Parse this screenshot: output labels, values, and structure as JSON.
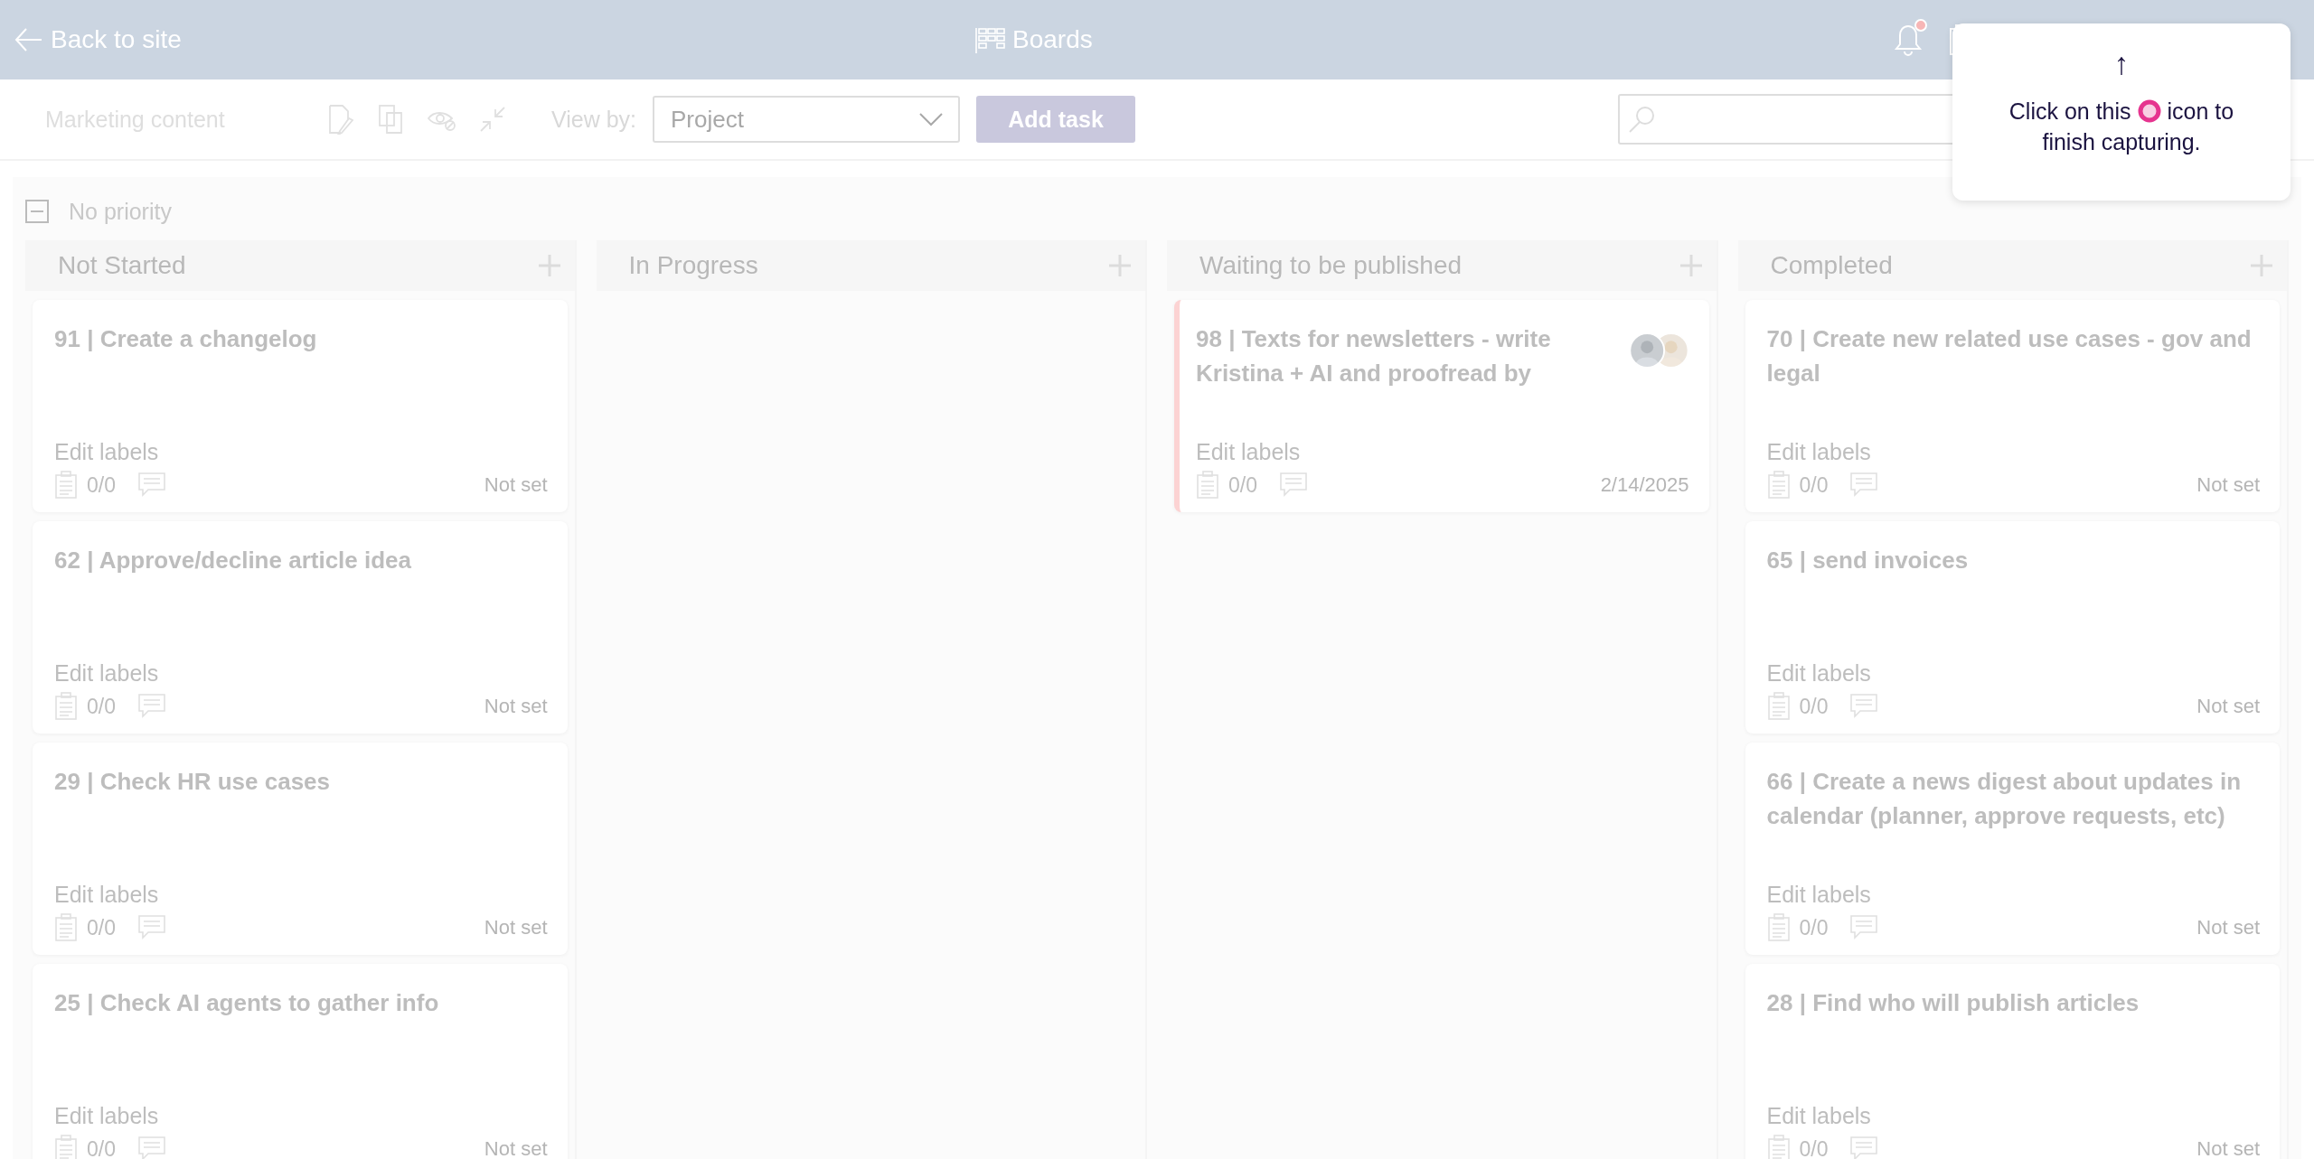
{
  "header": {
    "back_link": "Back to site",
    "title": "Boards",
    "notification": true
  },
  "toolbar": {
    "board_name": "Marketing content",
    "view_by_label": "View by:",
    "view_by": {
      "value": "Project"
    },
    "add_task": "Add task"
  },
  "group": {
    "label": "No priority",
    "expanded": true
  },
  "columns": [
    {
      "title": "Not Started",
      "cards": [
        {
          "title": "91 | Create a changelog",
          "labels": "Edit labels",
          "checklist": "0/0",
          "due": "Not set",
          "flagged": false
        },
        {
          "title": "62 | Approve/decline article idea",
          "labels": "Edit labels",
          "checklist": "0/0",
          "due": "Not set",
          "flagged": false
        },
        {
          "title": "29 | Check HR use cases",
          "labels": "Edit labels",
          "checklist": "0/0",
          "due": "Not set",
          "flagged": false
        },
        {
          "title": "25 | Check AI agents to gather info",
          "labels": "Edit labels",
          "checklist": "0/0",
          "due": "Not set",
          "flagged": false
        }
      ]
    },
    {
      "title": "In Progress"
    },
    {
      "title": "Waiting to be published",
      "cards": [
        {
          "title": "98 | Texts for newsletters - write Kristina + AI and proofread by",
          "labels": "Edit labels",
          "checklist": "0/0",
          "due": "2/14/2025",
          "flagged": true
        }
      ]
    },
    {
      "title": "Completed",
      "cards": [
        {
          "title": "70 | Create new related use cases - gov and legal",
          "labels": "Edit labels",
          "checklist": "0/0",
          "due": "Not set",
          "flagged": false
        },
        {
          "title": "65 | send invoices",
          "labels": "Edit labels",
          "checklist": "0/0",
          "due": "Not set",
          "flagged": false
        },
        {
          "title": "66 | Create a news digest about updates in calendar (planner, approve requests, etc)",
          "labels": "Edit labels",
          "checklist": "0/0",
          "due": "Not set",
          "flagged": false
        },
        {
          "title": "28 | Find who will publish articles",
          "labels": "Edit labels",
          "checklist": "0/0",
          "due": "Not set",
          "flagged": false
        }
      ]
    }
  ],
  "tooltip": {
    "arrow": "↑",
    "line_1_before": "Click on this",
    "line_1_after": "icon to",
    "line_2": "finish capturing."
  }
}
